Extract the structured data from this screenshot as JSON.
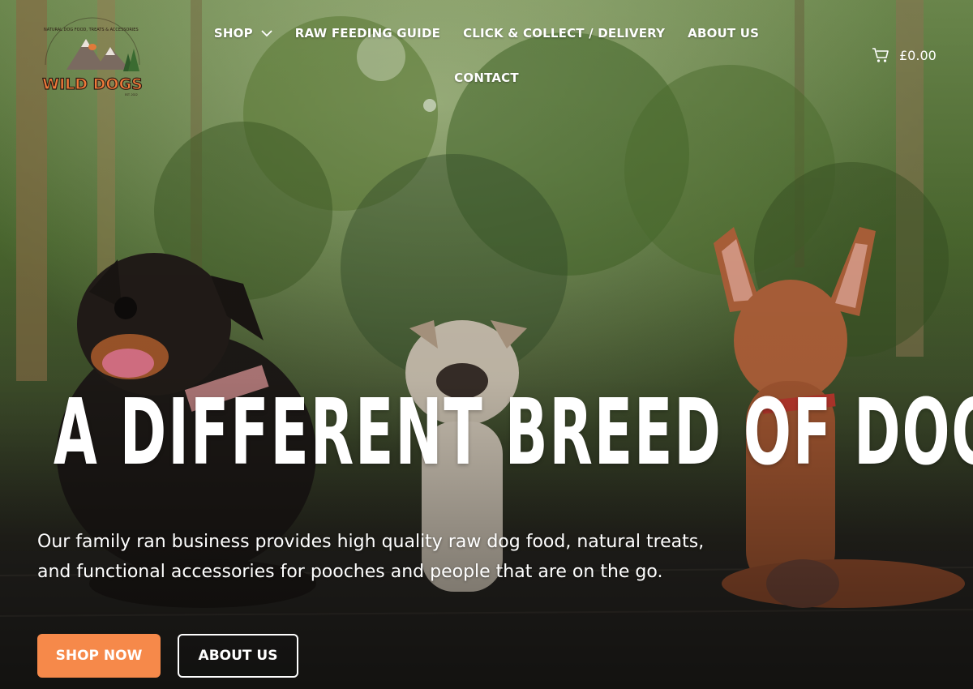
{
  "brand": {
    "logo_text": "WILD DOGS",
    "logo_ring_text": "NATURAL DOG FOOD, TREATS & ACCESSORIES",
    "logo_est_text": "EST. 2022"
  },
  "nav": {
    "items": [
      {
        "label": "SHOP",
        "has_dropdown": true
      },
      {
        "label": "RAW FEEDING GUIDE"
      },
      {
        "label": "CLICK & COLLECT / DELIVERY"
      },
      {
        "label": "ABOUT US"
      },
      {
        "label": "CONTACT"
      }
    ],
    "dropdown_icon": "chevron-down-icon"
  },
  "cart": {
    "icon": "cart-icon",
    "total": "£0.00"
  },
  "hero": {
    "headline": "A DIFFERENT BREED OF DOG S",
    "subtext": "Our family ran business provides high quality raw dog food, natural treats, and functional accessories for pooches and people that are on the go.",
    "primary_cta": "SHOP NOW",
    "secondary_cta": "ABOUT US"
  },
  "colors": {
    "accent": "#f6894a",
    "text": "#ffffff",
    "foliage": "#4b6b2f",
    "deck": "#2a2824"
  }
}
